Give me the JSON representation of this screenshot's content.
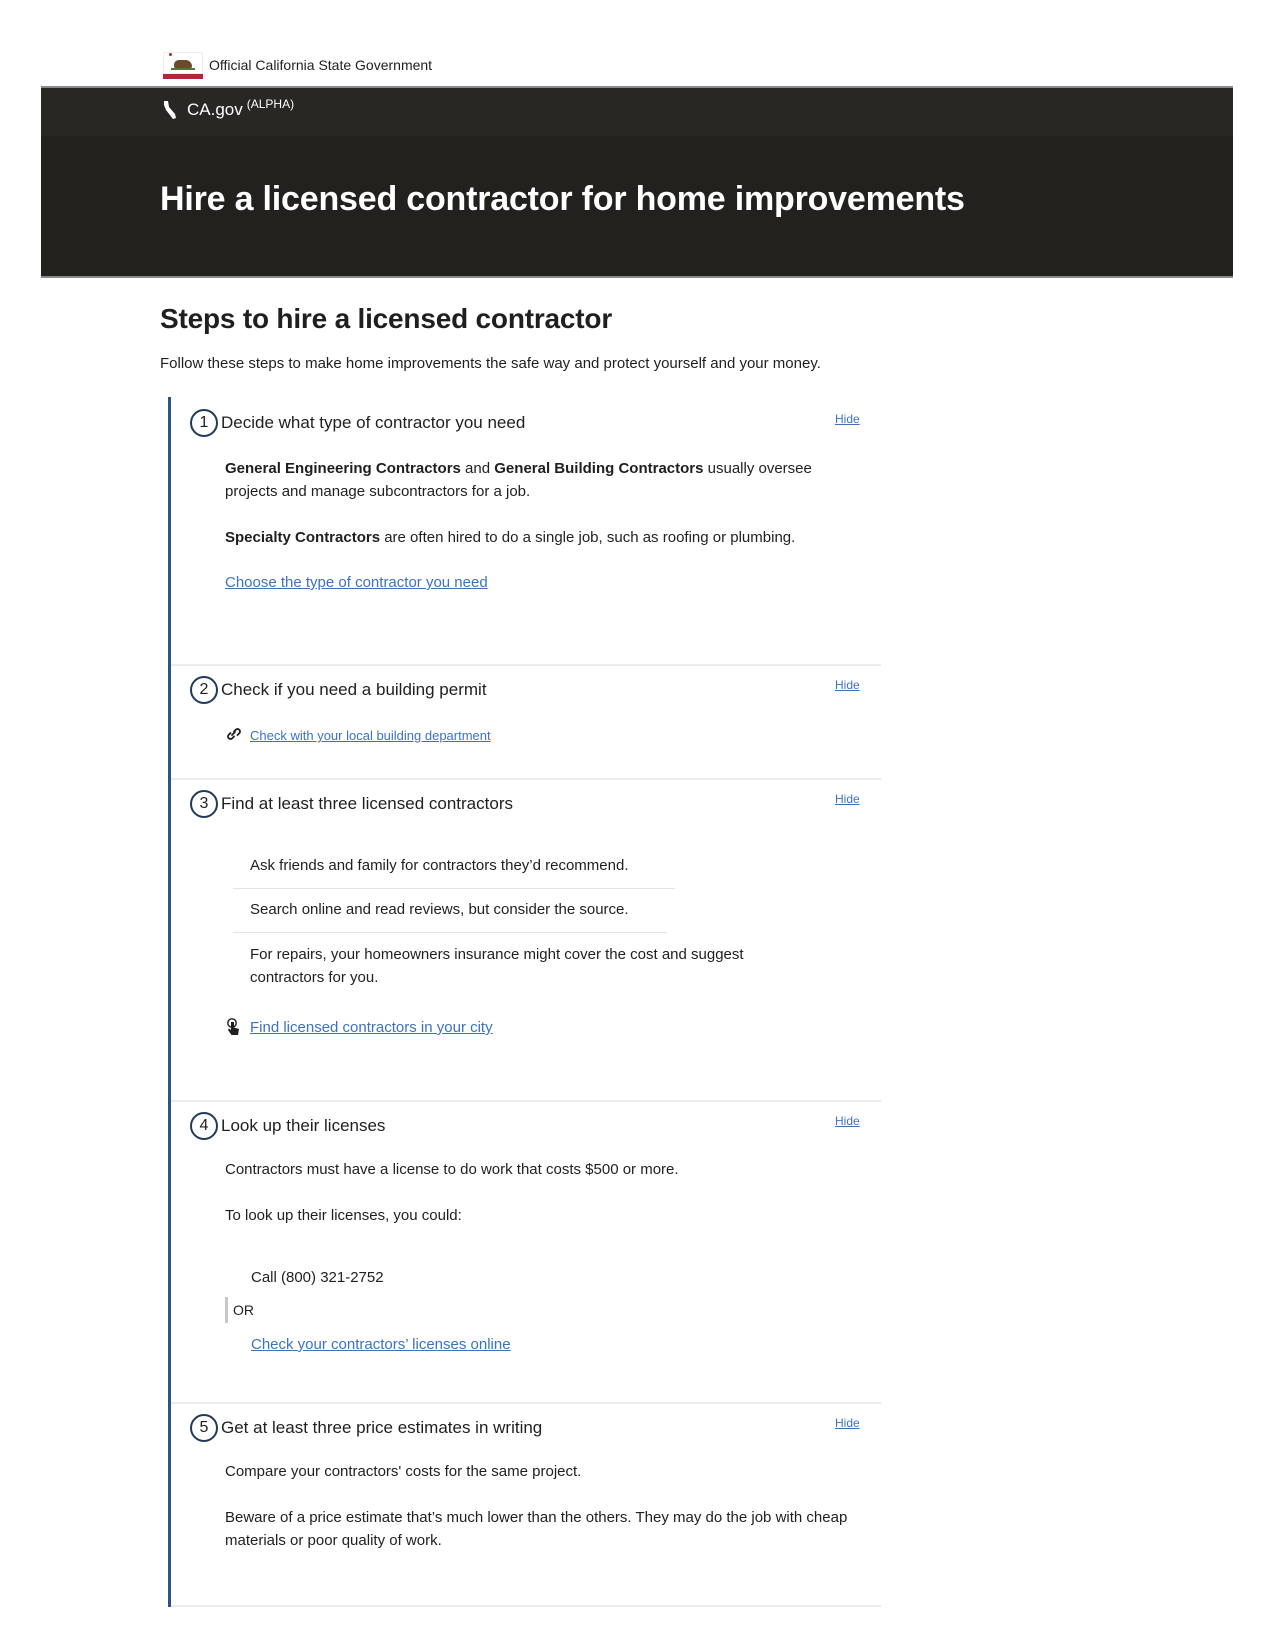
{
  "gov_bar": {
    "text": "Official California State Government",
    "icon": "california-flag-icon"
  },
  "nav": {
    "brand": "CA.gov",
    "tag": "(ALPHA)",
    "icon": "california-state-icon"
  },
  "hero": {
    "title": "Hire a licensed contractor for home improvements"
  },
  "section": {
    "title": "Steps to hire a licensed contractor",
    "intro": "Follow these steps to make home improvements the safe way and protect yourself and your money."
  },
  "colors": {
    "banner": "#22211e",
    "accent_bar": "#2d5480",
    "link": "#3d72c2"
  },
  "steps": [
    {
      "number": "1",
      "title": "Decide what type of contractor you need",
      "hide_label": "Hide",
      "p1_bold_a": "General Engineering Contractors",
      "p1_mid": " and ",
      "p1_bold_b": "General Building Contractors",
      "p1_rest": " usually oversee projects and manage subcontractors for a job.",
      "p2_bold": "Specialty Contractors",
      "p2_rest": " are often hired to do a single job, such as roofing or plumbing.",
      "link": "Choose the type of contractor you need"
    },
    {
      "number": "2",
      "title": "Check if you need a building permit",
      "hide_label": "Hide",
      "link_icon": "link-icon",
      "link": "Check with your local building department"
    },
    {
      "number": "3",
      "title": "Find at least three licensed contractors",
      "hide_label": "Hide",
      "items": [
        "Ask friends and family for contractors they’d recommend.",
        "Search online and read reviews, but consider the source.",
        "For repairs, your homeowners insurance might cover the cost and suggest contractors for you."
      ],
      "link_icon": "pointer-hand-icon",
      "link": "Find licensed contractors in your city"
    },
    {
      "number": "4",
      "title": "Look up their licenses",
      "hide_label": "Hide",
      "p1": "Contractors must have a license to do work that costs $500 or more.",
      "p2": "To look up their licenses, you could:",
      "call": "Call (800) 321-2752",
      "or": "OR",
      "link": "Check your contractors’ licenses online"
    },
    {
      "number": "5",
      "title": "Get at least three price estimates in writing",
      "hide_label": "Hide",
      "p1": "Compare your contractors' costs for the same project.",
      "p2": "Beware of a price estimate that’s much lower than the others. They may do the job with cheap materials or poor quality of work."
    }
  ]
}
